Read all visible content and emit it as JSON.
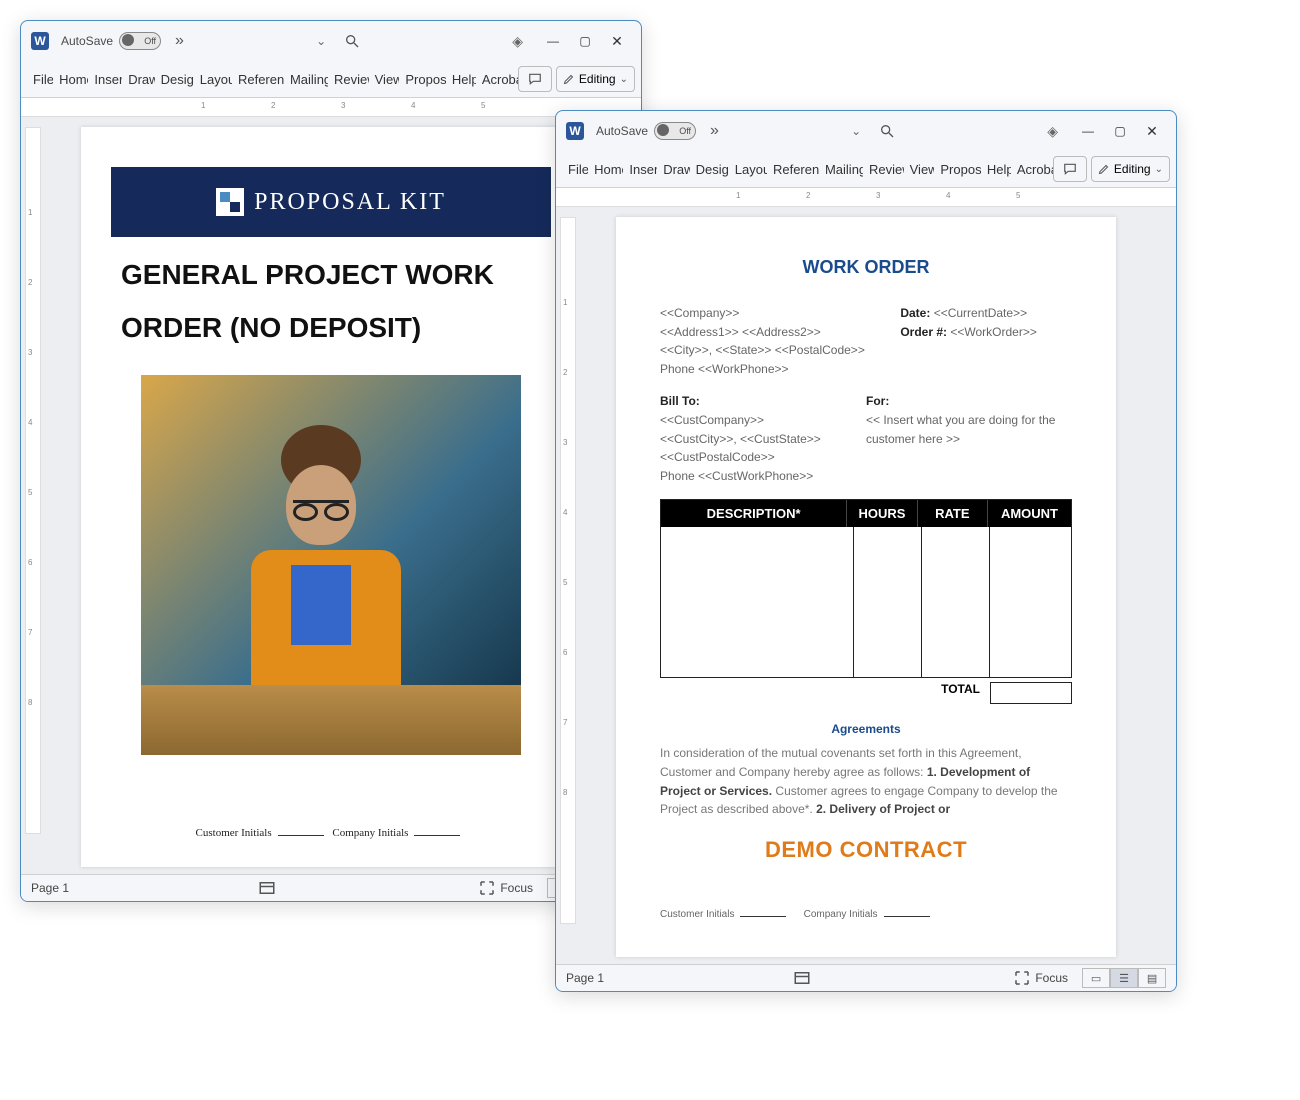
{
  "autosave": {
    "label": "AutoSave",
    "state": "Off"
  },
  "ribbon_tabs": [
    "File",
    "Home",
    "Insert",
    "Draw",
    "Design",
    "Layout",
    "References",
    "Mailings",
    "Review",
    "View",
    "Proposal",
    "Help",
    "Acrobat"
  ],
  "editing_label": "Editing",
  "status": {
    "page": "Page 1",
    "focus": "Focus"
  },
  "ruler_marks": [
    "1",
    "2",
    "3",
    "4",
    "5"
  ],
  "vruler_marks": [
    "1",
    "2",
    "3",
    "4",
    "5",
    "6",
    "7",
    "8"
  ],
  "docA": {
    "brand": "PROPOSAL KIT",
    "title_line1": "GENERAL PROJECT WORK",
    "title_line2": "ORDER (NO DEPOSIT)",
    "cust_initials": "Customer Initials",
    "comp_initials": "Company Initials"
  },
  "docB": {
    "title": "WORK ORDER",
    "company": "<<Company>>",
    "addr1": "<<Address1>> <<Address2>>",
    "city": "<<City>>, <<State>> <<PostalCode>>",
    "phone": "Phone <<WorkPhone>>",
    "date_label": "Date:",
    "date_val": "<<CurrentDate>>",
    "order_label": "Order #:",
    "order_val": "<<WorkOrder>>",
    "billto_h": "Bill To:",
    "cust_company": "<<CustCompany>>",
    "cust_city": "<<CustCity>>, <<CustState>>",
    "cust_postal": "<<CustPostalCode>>",
    "cust_phone": "Phone <<CustWorkPhone>>",
    "for_h": "For:",
    "for_text": "<< Insert what you are doing for the customer here >>",
    "col_desc": "DESCRIPTION*",
    "col_hours": "HOURS",
    "col_rate": "RATE",
    "col_amt": "AMOUNT",
    "total": "TOTAL",
    "agreements_h": "Agreements",
    "agree_1": "In consideration of the mutual covenants set forth in this Agreement, Customer and Company hereby agree as follows: ",
    "agree_b1": "1. Development of Project or Services.",
    "agree_2": " Customer agrees to engage Company to develop the Project as described above*. ",
    "agree_b2": "2. Delivery of Project or",
    "demo": "DEMO CONTRACT",
    "cust_initials": "Customer Initials",
    "comp_initials": "Company Initials"
  }
}
